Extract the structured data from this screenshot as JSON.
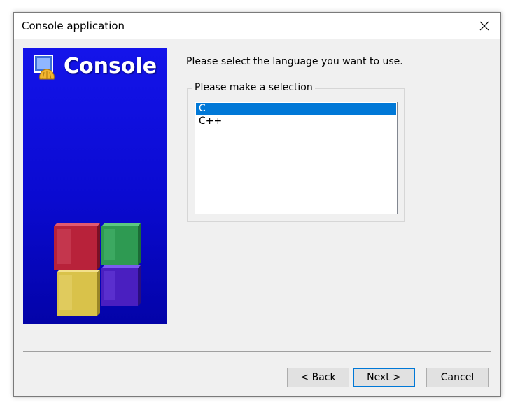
{
  "window": {
    "title": "Console application"
  },
  "banner": {
    "title": "Console",
    "cube_colors": {
      "red": "#b8223a",
      "green": "#2e9a52",
      "yellow": "#d9c24a",
      "purple": "#4a1fc0"
    },
    "background_color": "#1010e0"
  },
  "main": {
    "prompt": "Please select the language you want to use.",
    "group_label": "Please make a selection",
    "languages": [
      {
        "label": "C",
        "selected": true
      },
      {
        "label": "C++",
        "selected": false
      }
    ]
  },
  "buttons": {
    "back": "< Back",
    "next": "Next >",
    "cancel": "Cancel"
  },
  "colors": {
    "selection": "#0078d7",
    "dialog_bg": "#f0f0f0"
  },
  "icons": {
    "close": "close-icon",
    "app_logo": "codeblocks-logo-icon"
  }
}
